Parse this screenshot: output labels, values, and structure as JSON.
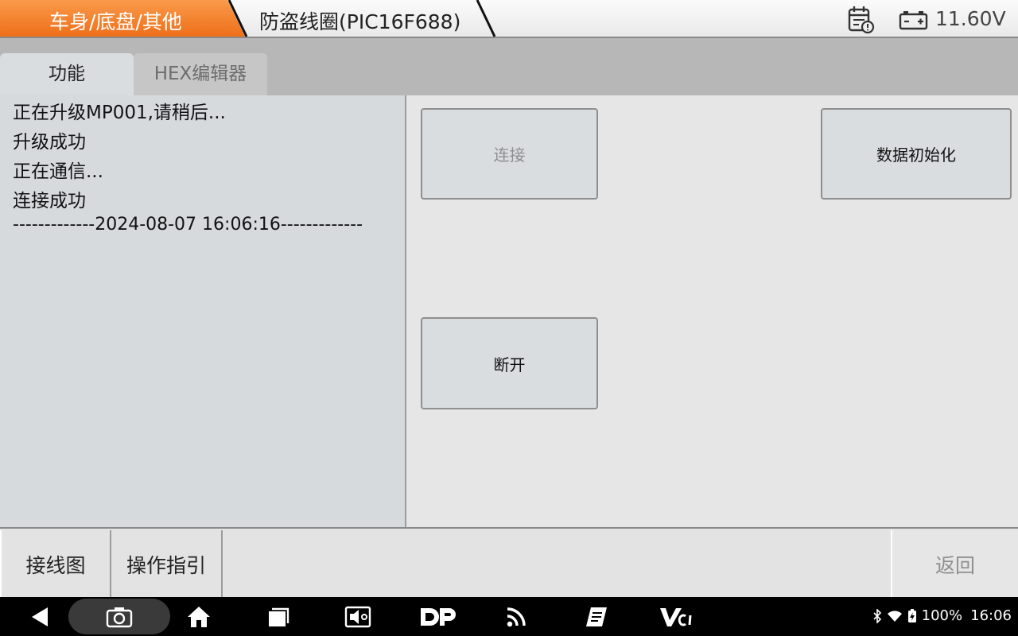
{
  "header": {
    "breadcrumb_main": "车身/底盘/其他",
    "breadcrumb_sub": "防盗线圈(PIC16F688)",
    "voltage": "11.60V",
    "accent_color": "#f5832a"
  },
  "tabs": [
    {
      "label": "功能",
      "active": true
    },
    {
      "label": "HEX编辑器",
      "active": false
    }
  ],
  "log": {
    "lines": [
      "正在升级MP001,请稍后...",
      "升级成功",
      "正在通信...",
      "连接成功",
      "-------------2024-08-07 16:06:16-------------"
    ]
  },
  "functions": {
    "connect": {
      "label": "连接",
      "enabled": false
    },
    "data_init": {
      "label": "数据初始化",
      "enabled": true
    },
    "disconnect": {
      "label": "断开",
      "enabled": true
    }
  },
  "action_bar": {
    "wiring": "接线图",
    "guide": "操作指引",
    "back": "返回"
  },
  "status_bar": {
    "battery": "100%",
    "time": "16:06",
    "icons": [
      "back-icon",
      "screenshot-icon",
      "home-icon",
      "recents-icon",
      "screen-record-icon",
      "dp-icon",
      "rss-icon",
      "notes-icon",
      "vci-icon",
      "bluetooth-icon",
      "wifi-icon",
      "battery-icon"
    ]
  }
}
